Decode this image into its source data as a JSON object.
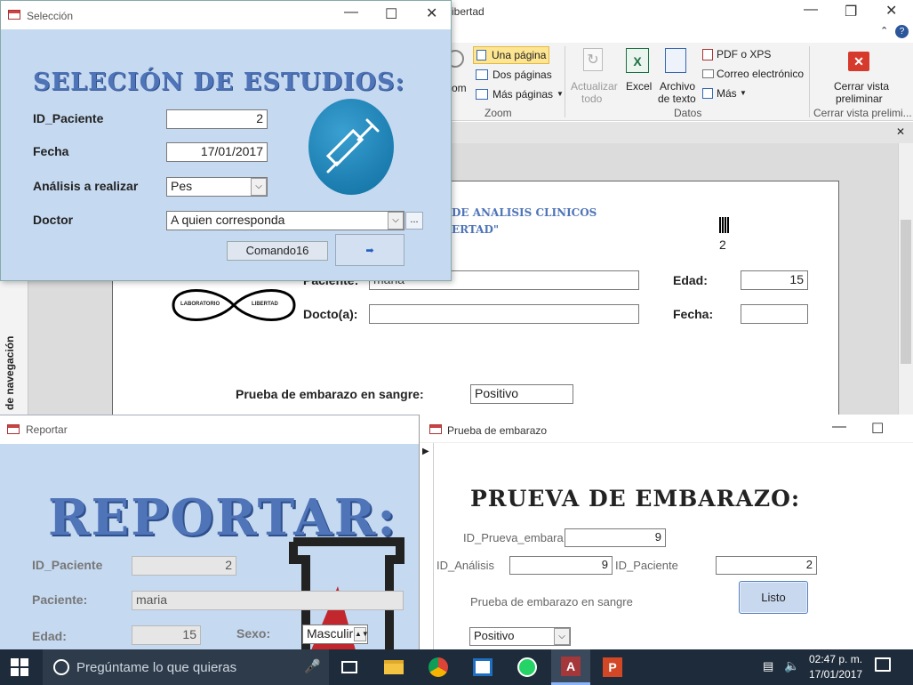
{
  "main_window": {
    "title_fragment": "ibertad",
    "help_glyph": "?"
  },
  "ribbon": {
    "zoom_partial": "om",
    "una_pagina": "Una página",
    "dos_paginas": "Dos páginas",
    "mas_paginas": "Más páginas",
    "group_zoom": "Zoom",
    "actualizar": "Actualizar",
    "todo": "todo",
    "excel": "Excel",
    "archivo": "Archivo",
    "de_texto": "de texto",
    "pdf": "PDF o XPS",
    "correo": "Correo electrónico",
    "mas": "Más",
    "group_datos": "Datos",
    "cerrar1": "Cerrar vista",
    "cerrar2": "preliminar",
    "group_cerrar": "Cerrar vista prelimi..."
  },
  "nav_pane": {
    "label": "de navegación"
  },
  "report_preview": {
    "header_line1": "DE ANALISIS CLINICOS",
    "header_line2": "ERTAD\"",
    "barcode_number": "2",
    "paciente_label": "Paciente:",
    "paciente_value": "maria",
    "edad_label": "Edad:",
    "edad_value": "15",
    "docto_label": "Docto(a):",
    "fecha_label": "Fecha:",
    "logo_left": "LABORATORIO",
    "logo_right": "LIBERTAD",
    "prueba_label": "Prueba de embarazo en sangre:",
    "prueba_value": "Positivo"
  },
  "seleccion": {
    "title": "Selección",
    "heading": "SELECIÓN DE ESTUDIOS:",
    "id_label": "ID_Paciente",
    "id_value": "2",
    "fecha_label": "Fecha",
    "fecha_value": "17/01/2017",
    "analisis_label": "Análisis a realizar",
    "analisis_value": "Pes",
    "doctor_label": "Doctor",
    "doctor_value": "A quien corresponda",
    "ellipsis": "...",
    "comando": "Comando16",
    "arrow": "➡"
  },
  "reportar": {
    "title": "Reportar",
    "heading": "REPORTAR:",
    "id_label": "ID_Paciente",
    "id_value": "2",
    "paciente_label": "Paciente:",
    "paciente_value": "maria",
    "edad_label": "Edad:",
    "edad_value": "15",
    "sexo_label": "Sexo:",
    "sexo_value": "Masculir"
  },
  "embarazo": {
    "title": "Prueba de embarazo",
    "heading": "PRUEVA DE EMBARAZO:",
    "id_prueva_label": "ID_Prueva_embara",
    "id_prueva_value": "9",
    "id_analisis_label": "ID_Análisis",
    "id_analisis_value": "9",
    "id_paciente_label": "ID_Paciente",
    "id_paciente_value": "2",
    "prueba_label": "Prueba de embarazo en sangre",
    "prueba_value": "Positivo",
    "listo": "Listo"
  },
  "taskbar": {
    "search_placeholder": "Pregúntame lo que quieras",
    "time": "02:47 p. m.",
    "date": "17/01/2017"
  },
  "colors": {
    "form_bg": "#c5d9f1",
    "heading_blue": "#4f74b8",
    "taskbar_bg": "#1e2b3a",
    "ribbon_bg": "#f3f3f3",
    "accent_highlight": "#fde591"
  }
}
